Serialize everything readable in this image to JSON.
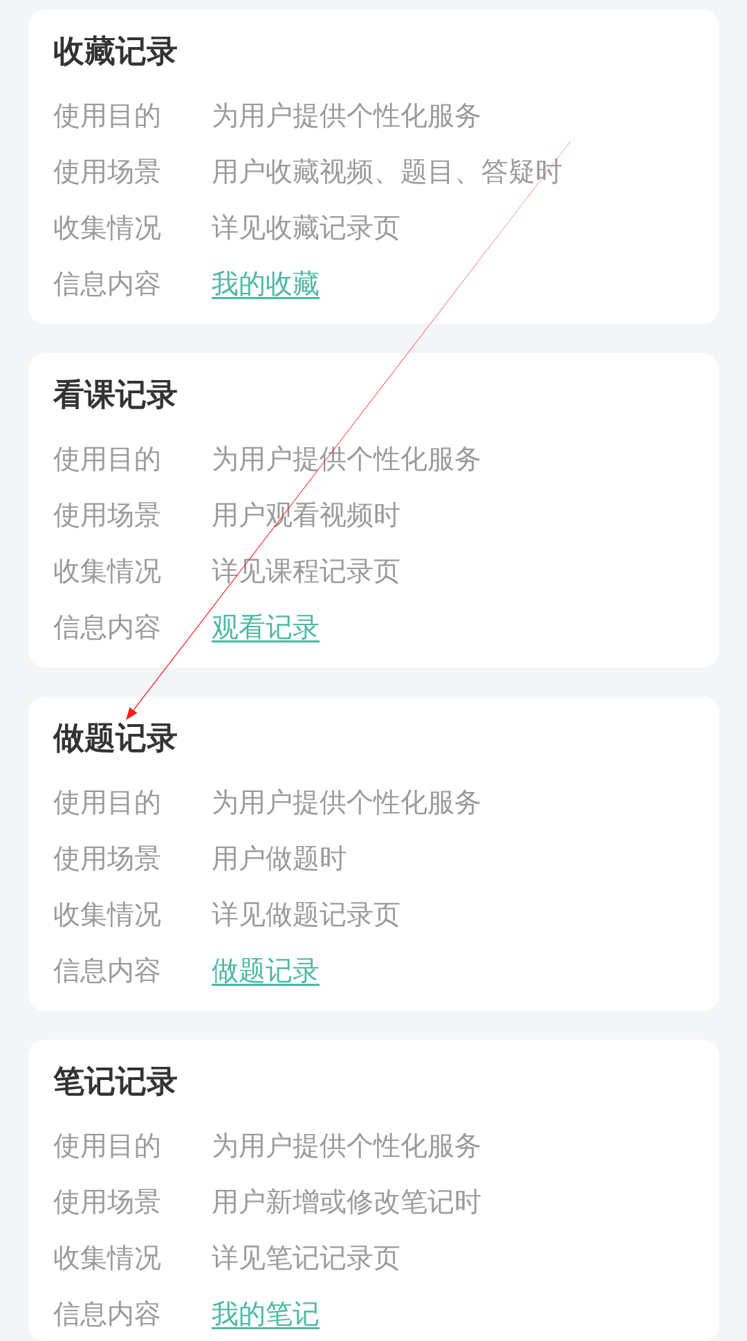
{
  "sections": [
    {
      "title": "收藏记录",
      "rows": [
        {
          "label": "使用目的",
          "value": "为用户提供个性化服务",
          "kind": "text"
        },
        {
          "label": "使用场景",
          "value": "用户收藏视频、题目、答疑时",
          "kind": "text"
        },
        {
          "label": "收集情况",
          "value": "详见收藏记录页",
          "kind": "text"
        },
        {
          "label": "信息内容",
          "value": "我的收藏",
          "kind": "link"
        }
      ]
    },
    {
      "title": "看课记录",
      "rows": [
        {
          "label": "使用目的",
          "value": "为用户提供个性化服务",
          "kind": "text"
        },
        {
          "label": "使用场景",
          "value": "用户观看视频时",
          "kind": "text"
        },
        {
          "label": "收集情况",
          "value": "详见课程记录页",
          "kind": "text"
        },
        {
          "label": "信息内容",
          "value": "观看记录",
          "kind": "link"
        }
      ]
    },
    {
      "title": "做题记录",
      "rows": [
        {
          "label": "使用目的",
          "value": "为用户提供个性化服务",
          "kind": "text"
        },
        {
          "label": "使用场景",
          "value": "用户做题时",
          "kind": "text"
        },
        {
          "label": "收集情况",
          "value": "详见做题记录页",
          "kind": "text"
        },
        {
          "label": "信息内容",
          "value": "做题记录",
          "kind": "link"
        }
      ]
    },
    {
      "title": "笔记记录",
      "rows": [
        {
          "label": "使用目的",
          "value": "为用户提供个性化服务",
          "kind": "text"
        },
        {
          "label": "使用场景",
          "value": "用户新增或修改笔记时",
          "kind": "text"
        },
        {
          "label": "收集情况",
          "value": "详见笔记记录页",
          "kind": "text"
        },
        {
          "label": "信息内容",
          "value": "我的笔记",
          "kind": "link"
        }
      ]
    }
  ]
}
